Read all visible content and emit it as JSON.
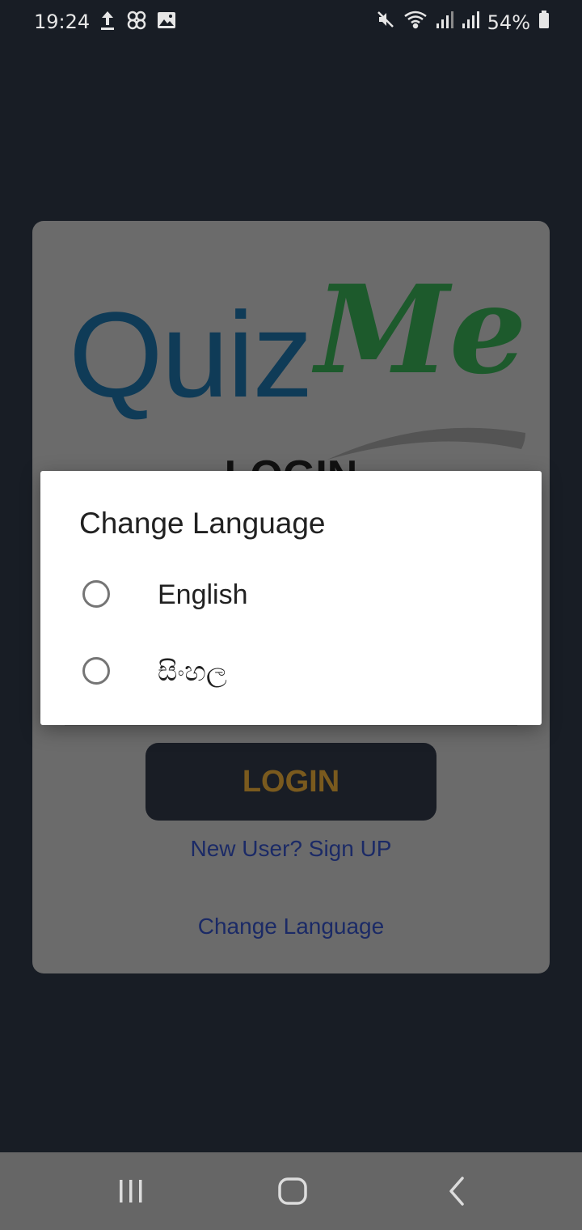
{
  "status_bar": {
    "time": "19:24",
    "battery": "54%",
    "icons_left": [
      "upload-icon",
      "app-grid-icon",
      "image-icon"
    ],
    "icons_right": [
      "mute-icon",
      "wifi-icon",
      "signal-icon",
      "signal-icon-2",
      "battery-icon"
    ]
  },
  "app": {
    "logo_quiz": "Quiz",
    "logo_me": "Me",
    "login_heading": "LOGIN",
    "login_button": "LOGIN",
    "signup_link": "New User? Sign UP",
    "change_language_link": "Change Language"
  },
  "dialog": {
    "title": "Change Language",
    "options": [
      {
        "label": "English",
        "selected": false
      },
      {
        "label": "සිංහල",
        "selected": false
      }
    ]
  },
  "colors": {
    "background": "#181d25",
    "card_dimmed": "#6b6b6b",
    "logo_blue": "#0f3b57",
    "logo_green": "#1d5a2c",
    "login_button_bg": "#191d25",
    "login_button_text": "#7a5a1e",
    "link": "#1b2a66"
  },
  "nav_bar": {
    "buttons": [
      "recents-icon",
      "home-icon",
      "back-icon"
    ]
  }
}
